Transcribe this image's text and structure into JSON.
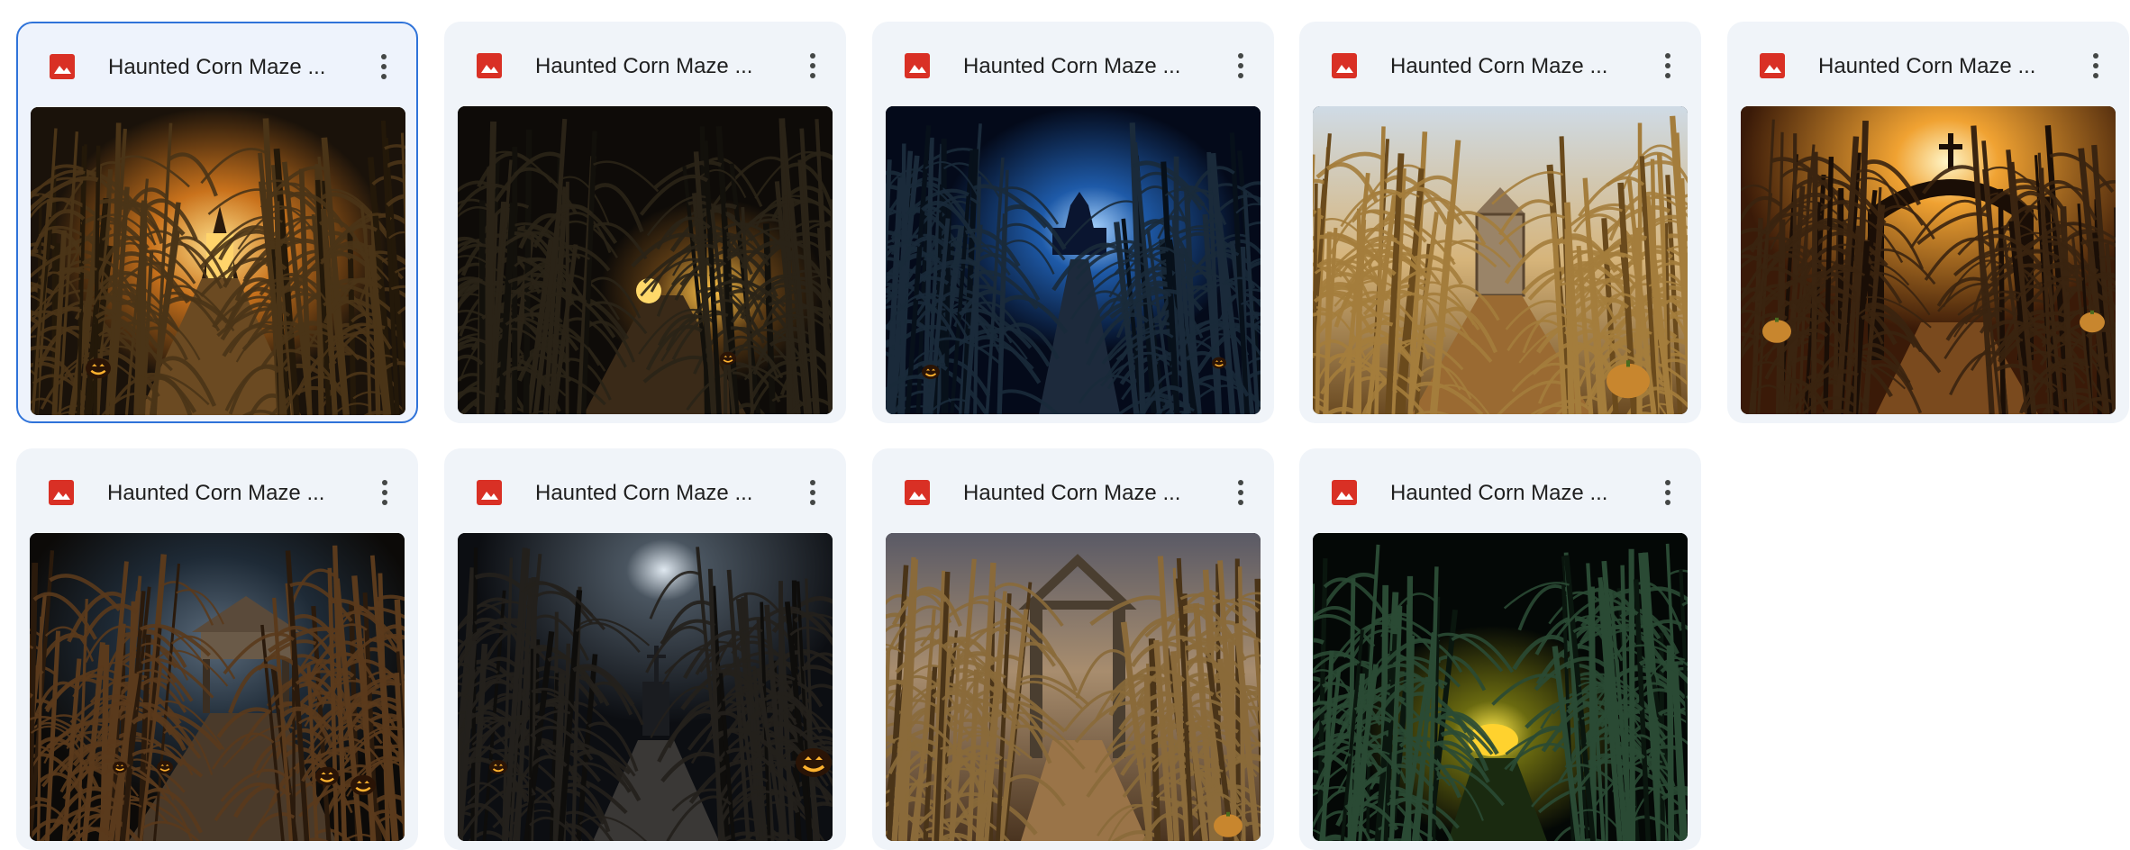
{
  "files": [
    {
      "title": "Haunted Corn Maze ...",
      "selected": true,
      "scene": "amber-tunnel"
    },
    {
      "title": "Haunted Corn Maze ...",
      "selected": false,
      "scene": "dark-glow"
    },
    {
      "title": "Haunted Corn Maze ...",
      "selected": false,
      "scene": "blue-night-church"
    },
    {
      "title": "Haunted Corn Maze ...",
      "selected": false,
      "scene": "day-door"
    },
    {
      "title": "Haunted Corn Maze ...",
      "selected": false,
      "scene": "sunset-gate"
    },
    {
      "title": "Haunted Corn Maze ...",
      "selected": false,
      "scene": "wooden-gate-pumpkins"
    },
    {
      "title": "Haunted Corn Maze ...",
      "selected": false,
      "scene": "moonlit-chapel"
    },
    {
      "title": "Haunted Corn Maze ...",
      "selected": false,
      "scene": "stone-arch-dusk"
    },
    {
      "title": "Haunted Corn Maze ...",
      "selected": false,
      "scene": "green-yellow-glow"
    }
  ],
  "colors": {
    "file_icon": "#d93025",
    "selection_border": "#2f73d9",
    "card_bg": "#f0f4f9"
  },
  "icons": {
    "file_type": "image-icon",
    "menu": "more-vert-icon"
  }
}
